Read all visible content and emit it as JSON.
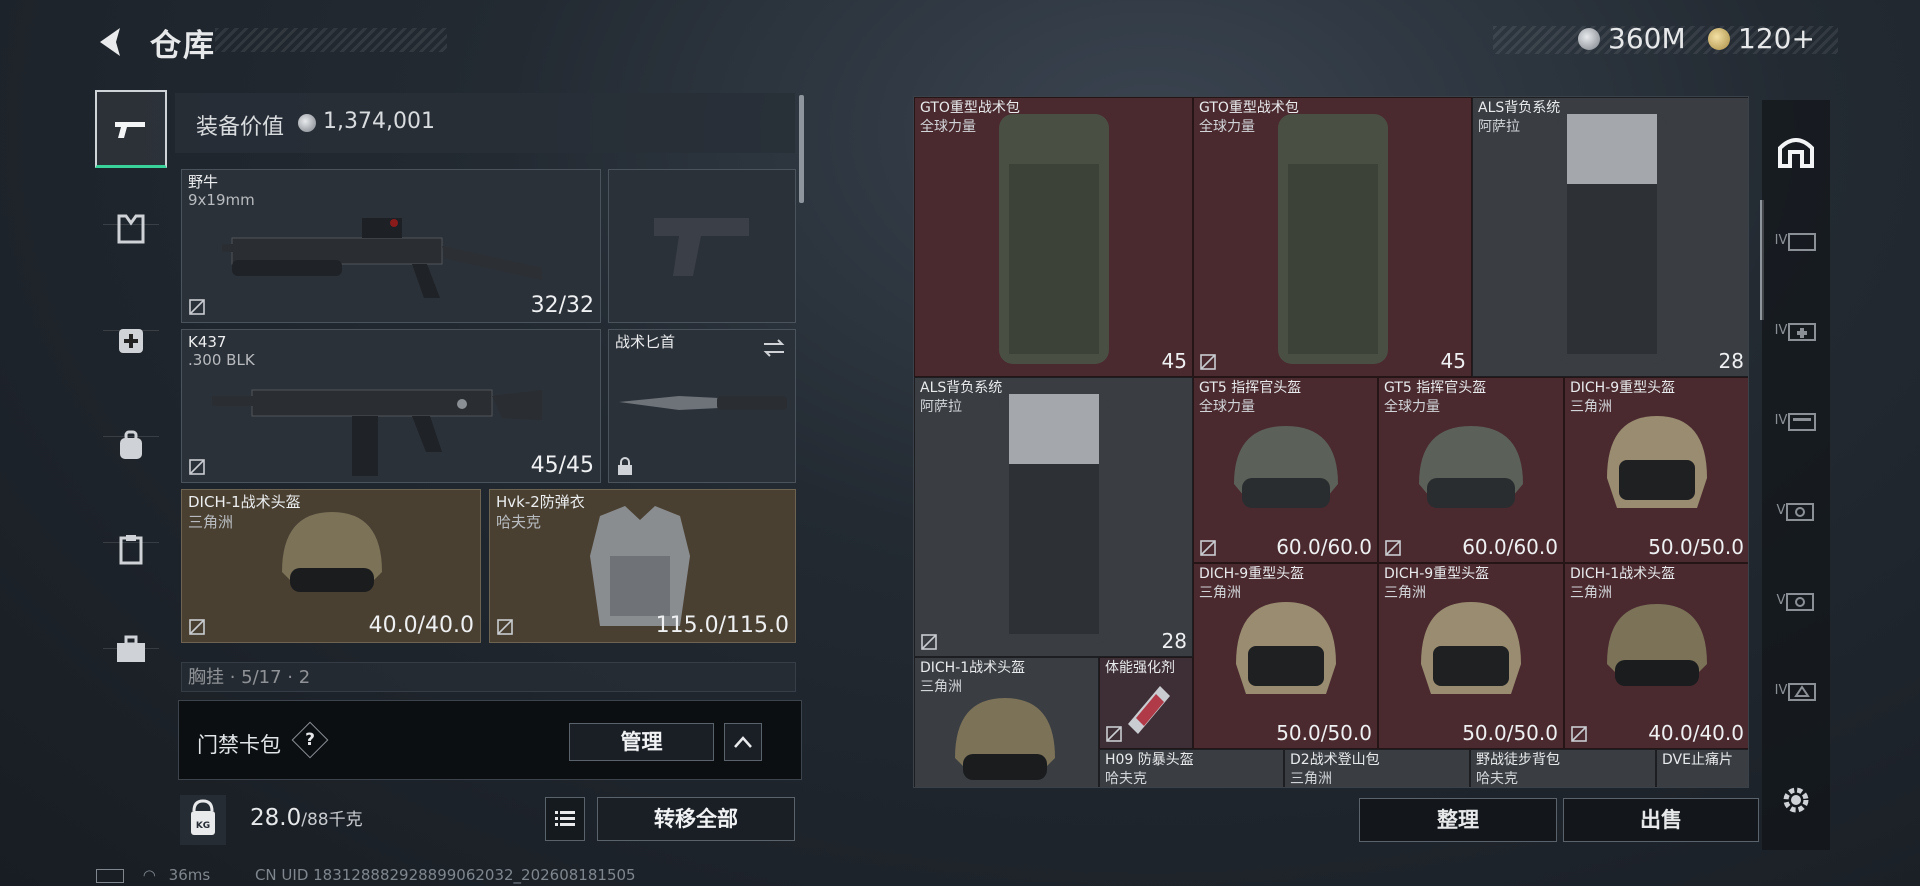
{
  "header": {
    "title": "仓库",
    "currencies": [
      {
        "icon": "silver-coin-icon",
        "value": "360M"
      },
      {
        "icon": "gold-coin-icon",
        "value": "120+"
      }
    ]
  },
  "nav": {
    "items": [
      {
        "icon": "gun-icon",
        "active": true
      },
      {
        "icon": "armor-icon",
        "active": false
      },
      {
        "icon": "first-aid-icon",
        "active": false
      },
      {
        "icon": "backpack-icon",
        "active": false
      },
      {
        "icon": "clipboard-icon",
        "active": false
      },
      {
        "icon": "toolbox-icon",
        "active": false
      }
    ]
  },
  "loadout": {
    "value_label": "装备价值",
    "value": "1,374,001",
    "primary": {
      "name": "野牛",
      "ammo": "9x19mm",
      "count": "32/32"
    },
    "secondary": {
      "name": "K437",
      "ammo": ".300 BLK",
      "count": "45/45"
    },
    "melee": {
      "name": "战术匕首"
    },
    "helmet": {
      "name": "DICH-1战术头盔",
      "maker": "三角洲",
      "durability": "40.0/40.0"
    },
    "armor": {
      "name": "Hvk-2防弹衣",
      "maker": "哈夫克",
      "durability": "115.0/115.0"
    },
    "partial": "胸挂 · 5/17 · 2"
  },
  "card_bar": {
    "label": "门禁卡包",
    "help": "?",
    "manage": "管理"
  },
  "footer": {
    "weight": "28.0",
    "weight_max": "/88千克",
    "transfer_all": "转移全部"
  },
  "status": {
    "ping": "36ms",
    "uid": "CN UID 18312888292889906​2032_202608181505"
  },
  "stash": {
    "items": [
      {
        "name": "GTO重型战术包",
        "maker": "全球力量",
        "count": "45"
      },
      {
        "name": "GTO重型战术包",
        "maker": "全球力量",
        "count": "45"
      },
      {
        "name": "ALS背负系统",
        "maker": "阿萨拉",
        "count": "28"
      },
      {
        "name": "ALS背负系统",
        "maker": "阿萨拉",
        "count": "28"
      },
      {
        "name": "GT5 指挥官头盔",
        "maker": "全球力量",
        "count": "60.0/60.0"
      },
      {
        "name": "GT5 指挥官头盔",
        "maker": "全球力量",
        "count": "60.0/60.0"
      },
      {
        "name": "DICH-9重型头盔",
        "maker": "三角洲",
        "count": "50.0/50.0"
      },
      {
        "name": "DICH-9重型头盔",
        "maker": "三角洲",
        "count": "50.0/50.0"
      },
      {
        "name": "DICH-9重型头盔",
        "maker": "三角洲",
        "count": "50.0/50.0"
      },
      {
        "name": "DICH-1战术头盔",
        "maker": "三角洲",
        "count": "40.0/40.0"
      },
      {
        "name": "DICH-1战术头盔",
        "maker": "三角洲",
        "count": ""
      },
      {
        "name": "体能强化剂",
        "maker": "",
        "count": ""
      },
      {
        "name": "H09 防暴头盔",
        "maker": "哈夫克",
        "count": ""
      },
      {
        "name": "D2战术登山包",
        "maker": "三角洲",
        "count": ""
      },
      {
        "name": "野战徒步背包",
        "maker": "哈夫克",
        "count": ""
      },
      {
        "name": "DVE止痛片",
        "maker": "",
        "count": ""
      }
    ],
    "sort_button": "整理",
    "sell_button": "出售"
  },
  "side": {
    "items": [
      "IV",
      "IV",
      "IV",
      "V",
      "V",
      "IV"
    ]
  }
}
